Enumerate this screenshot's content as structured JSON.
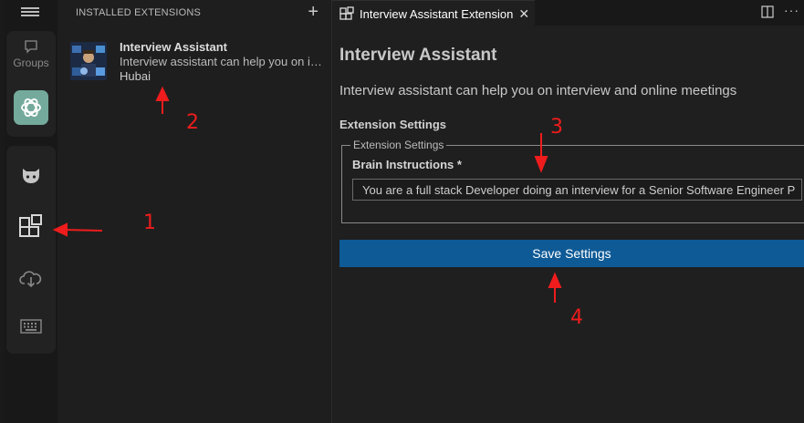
{
  "activity_bar": {
    "groups_label": "Groups"
  },
  "side_panel": {
    "header": "INSTALLED EXTENSIONS",
    "add_label": "+",
    "extension": {
      "name": "Interview Assistant",
      "description": "Interview assistant can help you on interview and online meetings",
      "author": "Hubai"
    }
  },
  "editor": {
    "tab": {
      "label": "Interview Assistant Extension",
      "close": "✕"
    },
    "more_label": "···",
    "title": "Interview Assistant",
    "description": "Interview assistant can help you on interview and online meetings",
    "section_title": "Extension Settings",
    "fieldset_legend": "Extension Settings",
    "field_label": "Brain Instructions *",
    "field_value": "You are a full stack Developer doing an interview for a Senior Software Engineer P",
    "save_button": "Save Settings"
  },
  "annotations": {
    "n1": "1",
    "n2": "2",
    "n3": "3",
    "n4": "4"
  },
  "colors": {
    "accent_button": "#0e5a96",
    "ai_icon_bg": "#74aa9c",
    "annotation": "#ee1c1c"
  }
}
